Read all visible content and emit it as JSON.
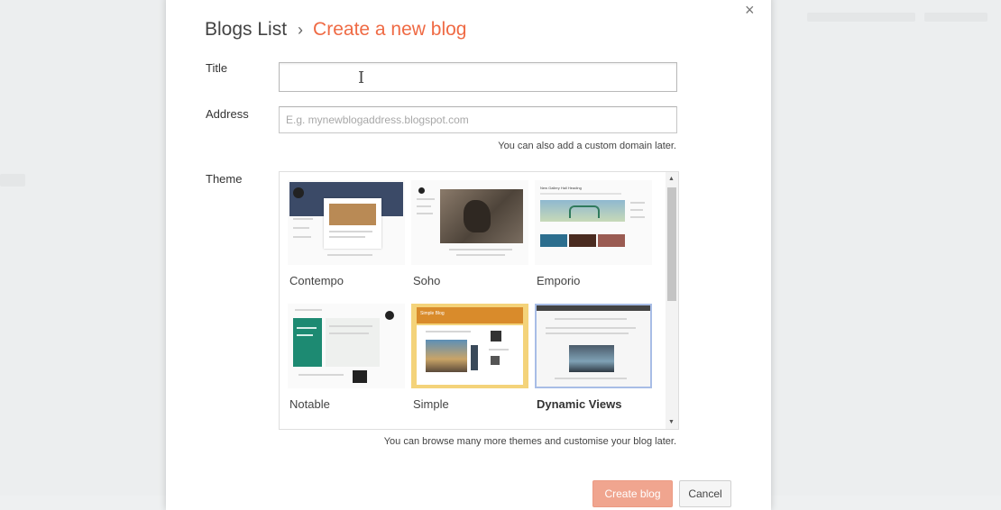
{
  "breadcrumb": {
    "root": "Blogs List",
    "separator": "›",
    "current": "Create a new blog"
  },
  "close_label": "×",
  "form": {
    "title_label": "Title",
    "title_value": "",
    "address_label": "Address",
    "address_placeholder": "E.g. mynewblogaddress.blogspot.com",
    "address_hint": "You can also add a custom domain later.",
    "theme_label": "Theme",
    "theme_hint": "You can browse many more themes and customise your blog later."
  },
  "themes": [
    {
      "name": "Contempo",
      "selected": false
    },
    {
      "name": "Soho",
      "selected": false
    },
    {
      "name": "Emporio",
      "selected": false
    },
    {
      "name": "Notable",
      "selected": false
    },
    {
      "name": "Simple",
      "selected": false
    },
    {
      "name": "Dynamic Views",
      "selected": true
    }
  ],
  "thumb_text": {
    "simple_header": "Simple Blog",
    "emporio_header": "New Gallery Hall Heading"
  },
  "buttons": {
    "create": "Create blog",
    "cancel": "Cancel"
  },
  "colors": {
    "accent": "#ef6a44",
    "primary_button": "#f0a58f",
    "selected_border": "#a8bde6",
    "notable_green": "#1d8a72",
    "simple_orange": "#d98b2b"
  }
}
